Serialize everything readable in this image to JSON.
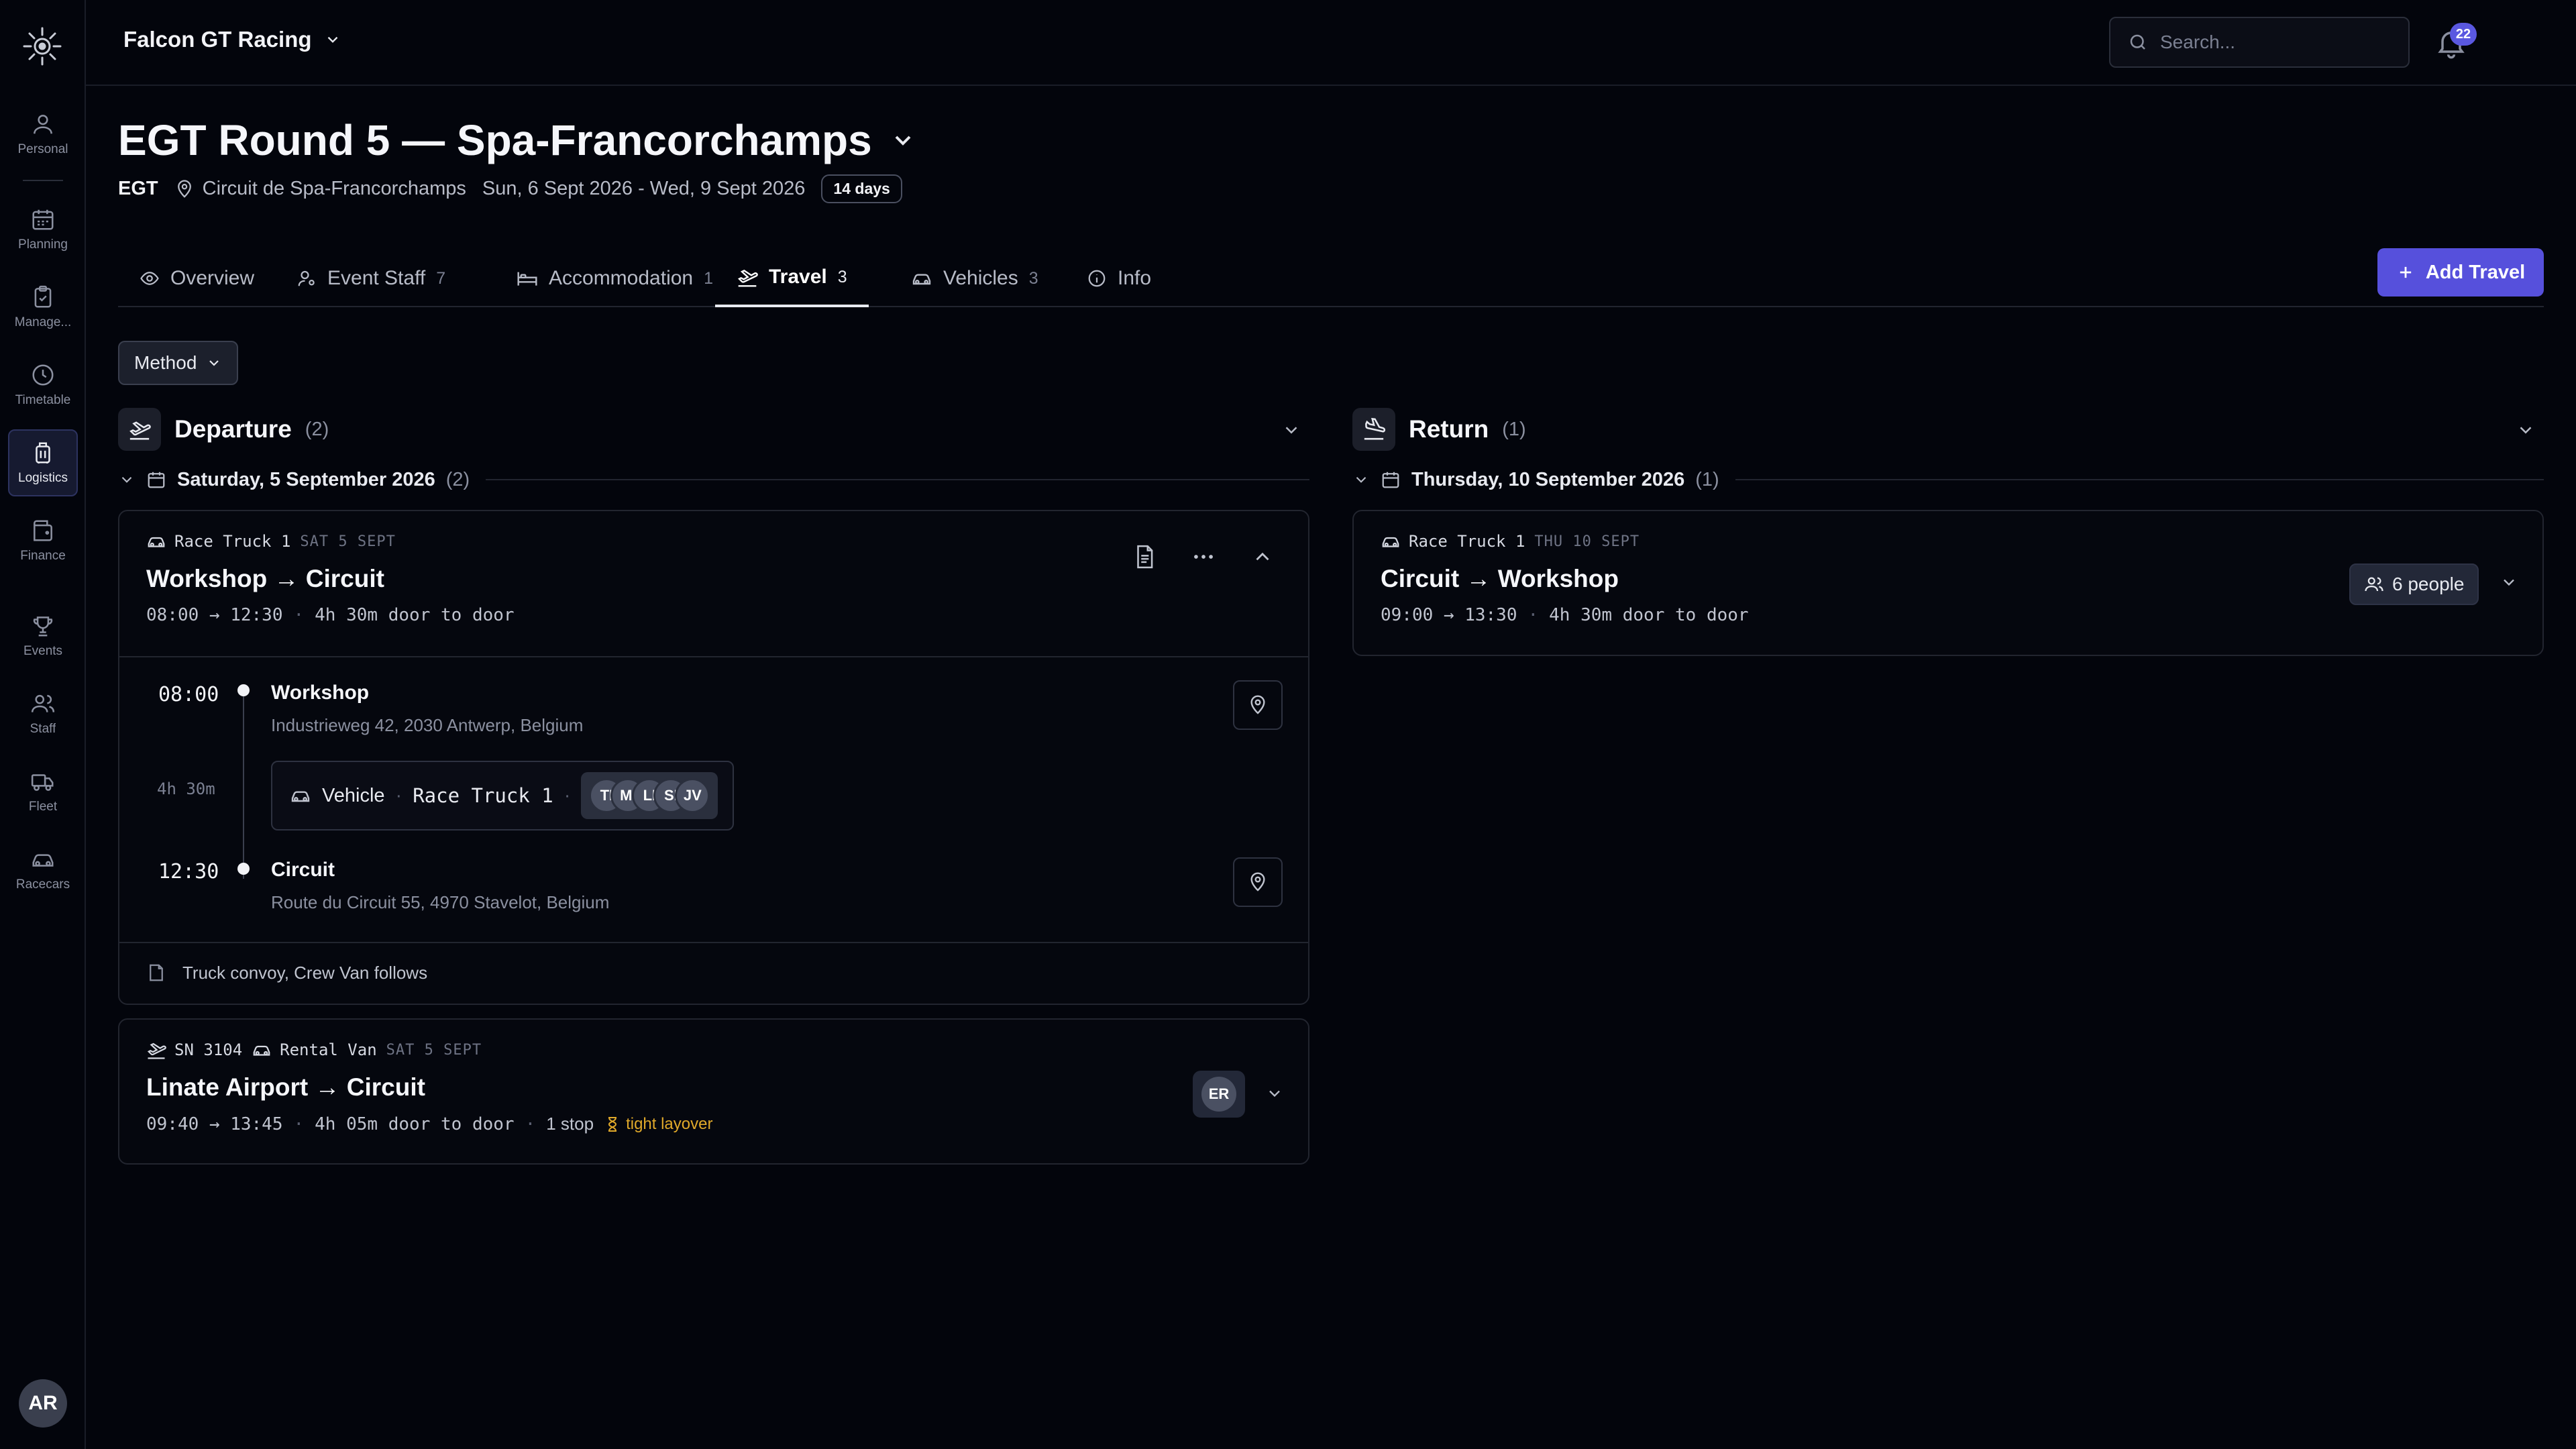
{
  "sidebar": {
    "logo": "gear-sun-icon",
    "items": [
      {
        "label": "Personal",
        "icon": "user-icon"
      },
      {
        "label": "Planning",
        "icon": "calendar-icon"
      },
      {
        "label": "Manage...",
        "icon": "clipboard-icon"
      },
      {
        "label": "Timetable",
        "icon": "clock-icon"
      },
      {
        "label": "Logistics",
        "icon": "luggage-icon",
        "active": true
      },
      {
        "label": "Finance",
        "icon": "wallet-icon"
      },
      {
        "label": "Events",
        "icon": "trophy-icon"
      },
      {
        "label": "Staff",
        "icon": "users-icon"
      },
      {
        "label": "Fleet",
        "icon": "truck-icon"
      },
      {
        "label": "Racecars",
        "icon": "car-icon"
      }
    ],
    "user_initials": "AR"
  },
  "topbar": {
    "org_name": "Falcon GT Racing",
    "search_placeholder": "Search...",
    "notification_count": "22"
  },
  "event": {
    "title": "EGT Round 5 — Spa-Francorchamps",
    "series": "EGT",
    "location": "Circuit de Spa-Francorchamps",
    "dates": "Sun, 6 Sept 2026 - Wed, 9 Sept 2026",
    "duration": "14 days"
  },
  "tabs": [
    {
      "label": "Overview",
      "count": ""
    },
    {
      "label": "Event Staff",
      "count": "7"
    },
    {
      "label": "Accommodation",
      "count": "1"
    },
    {
      "label": "Travel",
      "count": "3",
      "active": true
    },
    {
      "label": "Vehicles",
      "count": "3"
    },
    {
      "label": "Info",
      "count": ""
    }
  ],
  "add_travel_label": "Add Travel",
  "filter": {
    "method_label": "Method"
  },
  "departure": {
    "title": "Departure",
    "count": "(2)",
    "date_label": "Saturday, 5 September 2026",
    "date_count": "(2)",
    "trips": [
      {
        "vehicle": "Race Truck 1",
        "date": "SAT 5 SEPT",
        "title": "Workshop → Circuit",
        "time": "08:00 → 12:30",
        "door_to_door": "4h 30m door to door",
        "stops": [
          {
            "time": "08:00",
            "name": "Workshop",
            "address": "Industrieweg 42, 2030 Antwerp, Belgium"
          },
          {
            "time": "12:30",
            "name": "Circuit",
            "address": "Route du Circuit 55, 4970 Stavelot, Belgium"
          }
        ],
        "leg_duration": "4h 30m",
        "leg_type": "Vehicle",
        "leg_vehicle": "Race Truck 1",
        "leg_people": [
          "TI",
          "MI",
          "LI",
          "SI",
          "JV"
        ],
        "note": "Truck convoy, Crew Van follows"
      },
      {
        "flight": "SN 3104",
        "vehicle": "Rental Van",
        "date": "SAT 5 SEPT",
        "title": "Linate Airport → Circuit",
        "time": "09:40 → 13:45",
        "door_to_door": "4h 05m door to door",
        "stops_label": "1 stop",
        "warning": "tight layover",
        "person": "ER"
      }
    ]
  },
  "return": {
    "title": "Return",
    "count": "(1)",
    "date_label": "Thursday, 10 September 2026",
    "date_count": "(1)",
    "trips": [
      {
        "vehicle": "Race Truck 1",
        "date": "THU 10 SEPT",
        "title": "Circuit → Workshop",
        "time": "09:00 → 13:30",
        "door_to_door": "4h 30m door to door",
        "people_label": "6 people"
      }
    ]
  },
  "colors": {
    "accent": "#5650dc",
    "warning": "#e0a92a",
    "background": "#03050c"
  }
}
